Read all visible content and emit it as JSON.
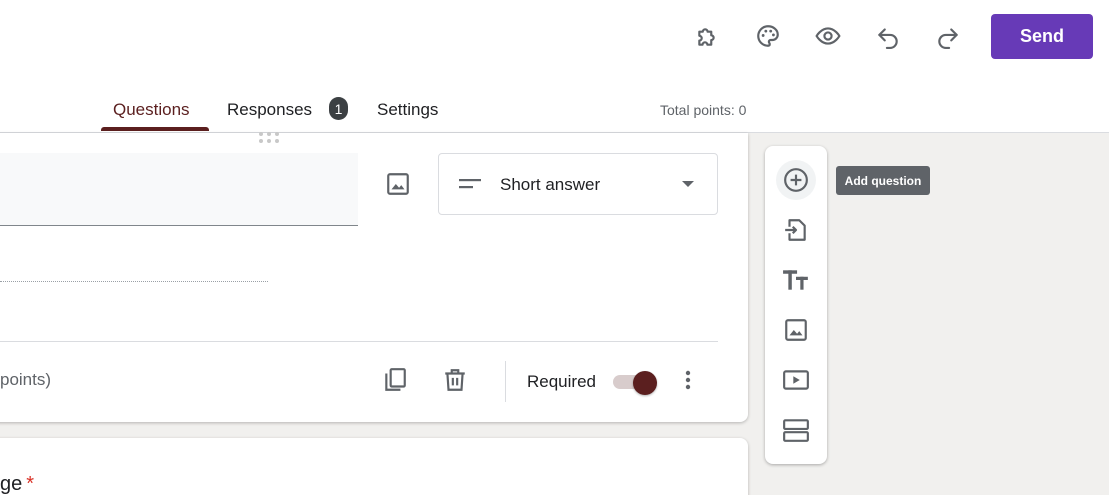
{
  "header": {
    "send_label": "Send",
    "icons": [
      "addons-icon",
      "palette-icon",
      "preview-eye-icon",
      "undo-icon",
      "redo-icon"
    ],
    "accent_color": "#673ab7"
  },
  "tabs": {
    "questions": "Questions",
    "responses": "Responses",
    "responses_count": "1",
    "settings": "Settings",
    "total_points": "Total points: 0",
    "theme_color": "#5b1f1f"
  },
  "question_card": {
    "type_label": "Short answer",
    "points_text": "points)",
    "required_label": "Required",
    "required_on": true
  },
  "next_card": {
    "title_fragment": "ge",
    "required_marker": "*"
  },
  "side_toolbar": {
    "tooltip": "Add question",
    "icons": [
      "add-question-icon",
      "import-questions-icon",
      "add-title-icon",
      "add-image-icon",
      "add-video-icon",
      "add-section-icon"
    ]
  }
}
